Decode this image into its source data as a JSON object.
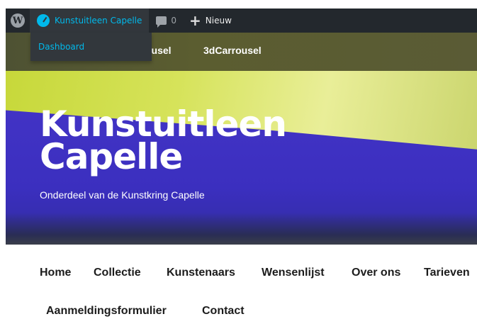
{
  "adminbar": {
    "wp_logo": "wordpress-icon",
    "site_name": "Kunstuitleen Capelle",
    "site_icon": "dashboard-icon",
    "comments_icon": "comment-icon",
    "comments_count": "0",
    "new_icon": "plus-icon",
    "new_label": "Nieuw"
  },
  "dropdown": {
    "dashboard_label": "Dashboard"
  },
  "subnav": {
    "items": [
      "ousel",
      "3dCarrousel"
    ]
  },
  "hero": {
    "title_line1": "Kunstuitleen",
    "title_line2": "Capelle",
    "tagline": "Onderdeel van de Kunstkring Capelle"
  },
  "menu": {
    "items": [
      "Home",
      "Collectie",
      "Kunstenaars",
      "Wensenlijst",
      "Over ons",
      "Tarieven",
      "Aanmeldingsformulier",
      "Contact"
    ]
  },
  "colors": {
    "adminbar_bg": "#23282d",
    "accent": "#00b9eb"
  }
}
